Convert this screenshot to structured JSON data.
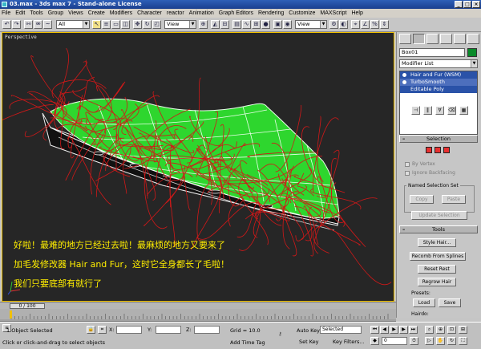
{
  "window": {
    "title": "03.max - 3ds max 7 - Stand-alone License",
    "min": "_",
    "max": "□",
    "close": "×"
  },
  "menu": [
    "File",
    "Edit",
    "Tools",
    "Group",
    "Views",
    "Create",
    "Modifiers",
    "Character",
    "reactor",
    "Animation",
    "Graph Editors",
    "Rendering",
    "Customize",
    "MAXScript",
    "Help"
  ],
  "toolbar": {
    "filter_value": "All",
    "refcoord_value": "View",
    "named_sel_value": "View"
  },
  "viewport": {
    "label": "Perspective",
    "captions": [
      "好啦！最难的地方已经过去啦！最麻烦的地方又要来了",
      "加毛发修改器 Hair and Fur，这时它全身都长了毛啦！",
      "我们只要底部有就行了"
    ],
    "mesh_color": "#2ed62e",
    "hair_color": "#d21818"
  },
  "command_panel": {
    "object_name": "Box01",
    "object_color": "#0a8a2a",
    "modifier_list_label": "Modifier List",
    "stack": [
      "Hair and Fur (WSM)",
      "TurboSmooth",
      "Editable Poly"
    ],
    "stack_buttons": [
      "pin-icon",
      "show-end-icon",
      "make-unique-icon",
      "remove-icon",
      "configure-icon"
    ],
    "selection": {
      "title": "Selection",
      "by_vertex": "By Vertex",
      "ignore_backfacing": "Ignore Backfacing",
      "named_selection_set": "Named Selection Set",
      "copy": "Copy",
      "paste": "Paste",
      "update_selection": "Update Selection"
    },
    "tools": {
      "title": "Tools",
      "style_hair": "Style Hair...",
      "recomb": "Recomb From Splines",
      "reset_rest": "Reset Rest",
      "regrow_hair": "Regrow Hair",
      "presets_label": "Presets:",
      "load": "Load",
      "save": "Save",
      "hairdo_label": "Hairdo:"
    }
  },
  "timeline": {
    "frame_readout": "0 / 100"
  },
  "status": {
    "selection_count": "1 Object Selected",
    "prompt": "Click or click-and-drag to select objects",
    "x_label": "X:",
    "y_label": "Y:",
    "z_label": "Z:",
    "grid": "Grid = 10.0",
    "add_time_tag": "Add Time Tag",
    "auto_key": "Auto Key",
    "auto_key_value": "Selected",
    "set_key": "Set Key",
    "key_filters": "Key Filters...",
    "current_frame": "0"
  }
}
